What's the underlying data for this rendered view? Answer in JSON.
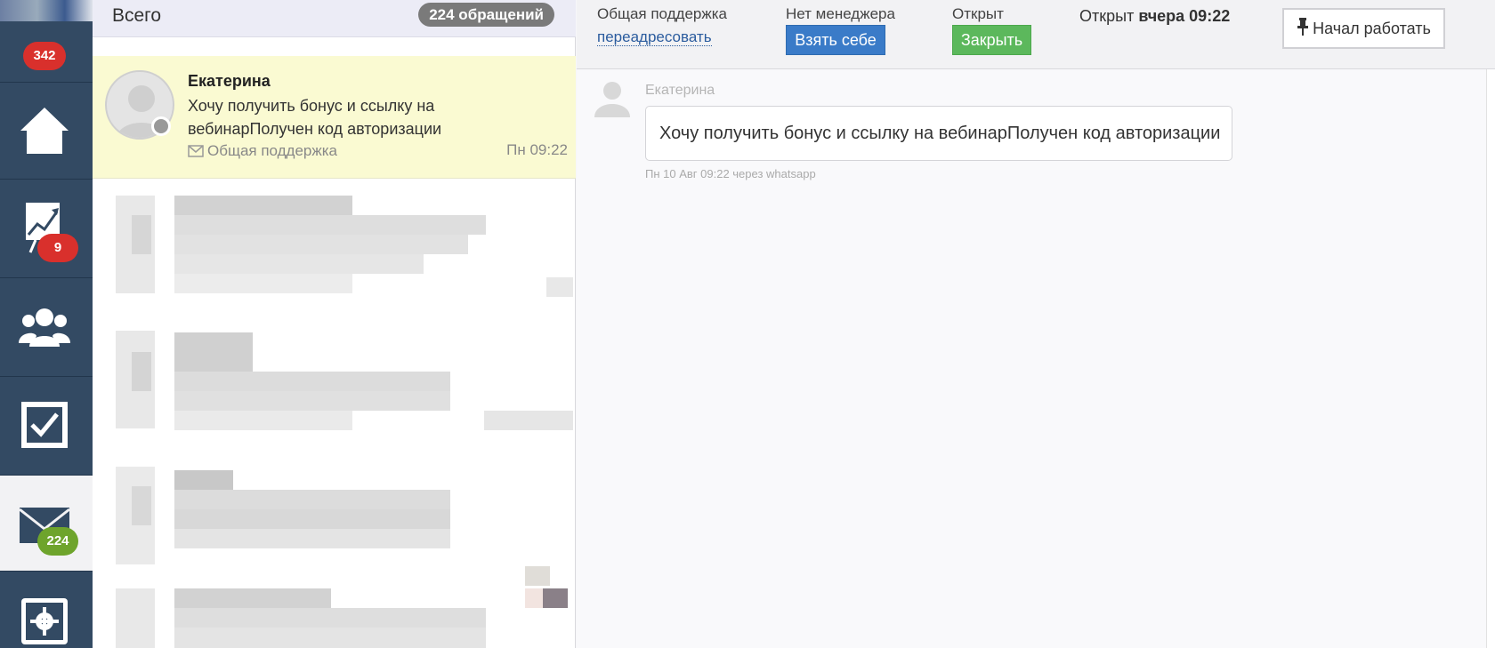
{
  "nav": {
    "top_badge": "342",
    "analytics_badge": "9",
    "mail_badge": "224"
  },
  "list": {
    "header_title": "Всего",
    "header_count": "224 обращений",
    "active_conversation": {
      "name": "Екатерина",
      "preview": "Хочу получить бонус и ссылку на вебинарПолучен код авторизации",
      "channel": "Общая поддержка",
      "time": "Пн 09:22"
    }
  },
  "topbar": {
    "department_label": "Общая поддержка",
    "redirect_link": "переадресовать",
    "manager_label": "Нет менеджера",
    "take_button": "Взять себе",
    "status_label": "Открыт",
    "close_button": "Закрыть",
    "opened_prefix": "Открыт",
    "opened_time": "вчера 09:22",
    "start_button": "Начал работать"
  },
  "message": {
    "author": "Екатерина",
    "text": "Хочу получить бонус и ссылку на вебинарПолучен код авторизации",
    "meta": "Пн 10 Авг 09:22 через whatsapp"
  },
  "colors": {
    "nav_bg": "#334a63",
    "badge_red": "#d9302c",
    "badge_green": "#6ea42c",
    "button_blue": "#3a7bc8",
    "button_green": "#5cb85c",
    "active_row_bg": "#fafad2"
  },
  "icons": [
    "home-icon",
    "analytics-icon",
    "users-icon",
    "tasks-icon",
    "mail-icon",
    "settings-icon",
    "envelope-icon",
    "pin-icon",
    "user-avatar-icon"
  ]
}
